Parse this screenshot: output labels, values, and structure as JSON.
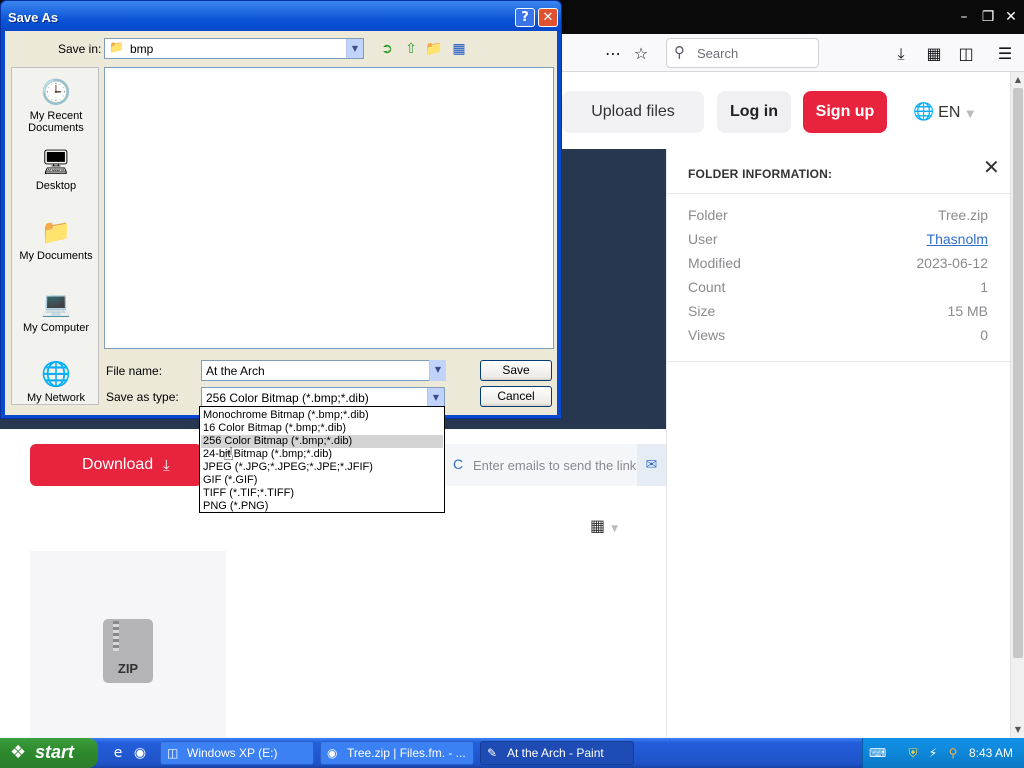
{
  "browser": {
    "search_placeholder": "Search",
    "header": {
      "upload_label": "Upload files",
      "login_label": "Log in",
      "signup_label": "Sign up",
      "language": "EN"
    },
    "folder_info": {
      "title": "FOLDER INFORMATION:",
      "rows": [
        {
          "key": "Folder",
          "value": "Tree.zip"
        },
        {
          "key": "User",
          "value": "Thasnolm"
        },
        {
          "key": "Modified",
          "value": "2023-06-12"
        },
        {
          "key": "Count",
          "value": "1"
        },
        {
          "key": "Size",
          "value": "15 MB"
        },
        {
          "key": "Views",
          "value": "0"
        }
      ]
    },
    "download_label": "Download",
    "email_partial": "C",
    "email_placeholder": "Enter emails to send the link",
    "file_icon_label": "ZIP"
  },
  "dialog": {
    "title": "Save As",
    "save_in_label": "Save in:",
    "save_in_value": "bmp",
    "places": [
      {
        "label": "My Recent Documents",
        "icon": "recent-documents-icon"
      },
      {
        "label": "Desktop",
        "icon": "desktop-icon"
      },
      {
        "label": "My Documents",
        "icon": "my-documents-icon"
      },
      {
        "label": "My Computer",
        "icon": "my-computer-icon"
      },
      {
        "label": "My Network",
        "icon": "my-network-icon"
      }
    ],
    "file_name_label": "File name:",
    "file_name_value": "At the Arch",
    "save_type_label": "Save as type:",
    "save_type_value": "256 Color Bitmap (*.bmp;*.dib)",
    "save_button": "Save",
    "cancel_button": "Cancel",
    "type_options": [
      "Monochrome Bitmap (*.bmp;*.dib)",
      "16 Color Bitmap (*.bmp;*.dib)",
      "256 Color Bitmap (*.bmp;*.dib)",
      "24-bit Bitmap (*.bmp;*.dib)",
      "JPEG (*.JPG;*.JPEG;*.JPE;*.JFIF)",
      "GIF (*.GIF)",
      "TIFF (*.TIF;*.TIFF)",
      "PNG (*.PNG)"
    ],
    "selected_option_index": 2
  },
  "taskbar": {
    "start_label": "start",
    "tasks": [
      {
        "label": "Windows XP (E:)",
        "active": false
      },
      {
        "label": "Tree.zip | Files.fm. - ...",
        "active": false
      },
      {
        "label": "At the Arch - Paint",
        "active": true
      }
    ],
    "clock": "8:43 AM"
  },
  "colors": {
    "accent_red": "#e8233d",
    "xp_blue": "#0a53d6",
    "link_blue": "#2f6fc9"
  }
}
